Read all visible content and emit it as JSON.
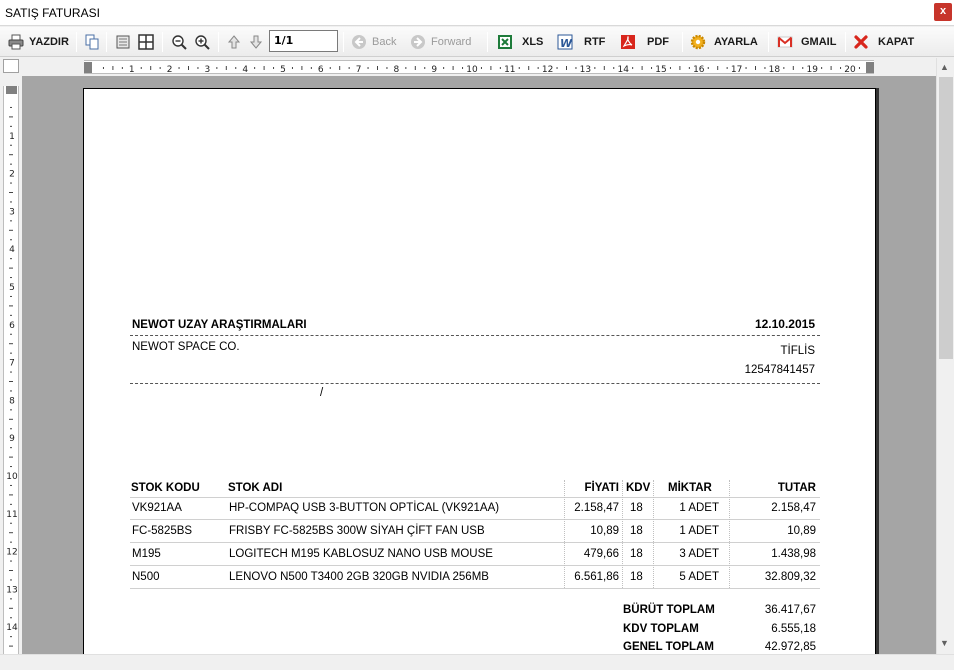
{
  "window": {
    "title": "SATIŞ FATURASI",
    "close_label": "x"
  },
  "toolbar": {
    "print_label": "YAZDIR",
    "page_value": "1/1",
    "back_label": "Back",
    "forward_label": "Forward",
    "xls_label": "XLS",
    "rtf_label": "RTF",
    "pdf_label": "PDF",
    "settings_label": "AYARLA",
    "gmail_label": "GMAIL",
    "close_label": "KAPAT"
  },
  "ruler": {
    "h_marks": [
      "1",
      "2",
      "3",
      "4",
      "5",
      "6",
      "7",
      "8",
      "9",
      "10",
      "11",
      "12",
      "13",
      "14",
      "15",
      "16",
      "17",
      "18",
      "19",
      "20"
    ],
    "v_marks": [
      "1",
      "2",
      "3",
      "4",
      "5",
      "6",
      "7",
      "8",
      "9",
      "10",
      "11",
      "12",
      "13",
      "14"
    ]
  },
  "invoice": {
    "company": "NEWOT UZAY ARAŞTIRMALARI",
    "date": "12.10.2015",
    "company_en": "NEWOT SPACE CO.",
    "city": "TİFLİS",
    "tax_no": "12547841457",
    "address_sep": "/",
    "columns": {
      "code": "STOK KODU",
      "name": "STOK ADI",
      "price": "FİYATI",
      "vat": "KDV",
      "qty": "MİKTAR",
      "total": "TUTAR"
    },
    "rows": [
      {
        "code": "VK921AA",
        "name": "HP-COMPAQ USB 3-BUTTON OPTİCAL (VK921AA)",
        "price": "2.158,47",
        "vat": "18",
        "qty": "1 ADET",
        "total": "2.158,47"
      },
      {
        "code": "FC-5825BS",
        "name": "FRISBY FC-5825BS 300W SİYAH ÇİFT FAN USB",
        "price": "10,89",
        "vat": "18",
        "qty": "1 ADET",
        "total": "10,89"
      },
      {
        "code": "M195",
        "name": "LOGITECH M195 KABLOSUZ NANO USB MOUSE",
        "price": "479,66",
        "vat": "18",
        "qty": "3 ADET",
        "total": "1.438,98"
      },
      {
        "code": "N500",
        "name": "LENOVO N500 T3400 2GB 320GB NVIDIA 256MB",
        "price": "6.561,86",
        "vat": "18",
        "qty": "5 ADET",
        "total": "32.809,32"
      }
    ],
    "totals": [
      {
        "label": "BÜRÜT TOPLAM",
        "value": "36.417,67"
      },
      {
        "label": "KDV TOPLAM",
        "value": "6.555,18"
      },
      {
        "label": "GENEL TOPLAM",
        "value": "42.972,85"
      }
    ]
  }
}
